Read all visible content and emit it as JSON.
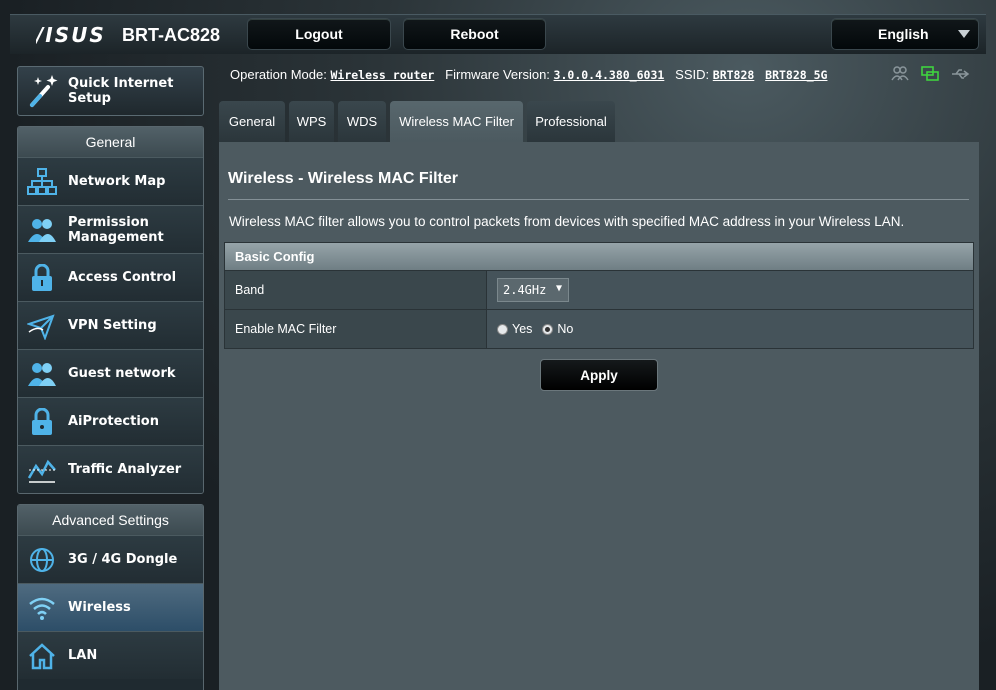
{
  "header": {
    "logo": "/ISUS",
    "model": "BRT-AC828",
    "logout_label": "Logout",
    "reboot_label": "Reboot",
    "language": "English"
  },
  "info": {
    "operation_mode_label": "Operation Mode:",
    "operation_mode": "Wireless router",
    "firmware_label": "Firmware Version:",
    "firmware": "3.0.0.4.380_6031",
    "ssid_label": "SSID:",
    "ssid_1": "BRT828",
    "ssid_2": "BRT828_5G"
  },
  "sidebar": {
    "qis_label_1": "Quick Internet",
    "qis_label_2": "Setup",
    "general_header": "General",
    "general_items": [
      {
        "label": "Network Map"
      },
      {
        "label_1": "Permission",
        "label_2": "Management"
      },
      {
        "label": "Access Control"
      },
      {
        "label": "VPN Setting"
      },
      {
        "label": "Guest network"
      },
      {
        "label": "AiProtection"
      },
      {
        "label": "Traffic Analyzer"
      }
    ],
    "advanced_header": "Advanced Settings",
    "advanced_items": [
      {
        "label": "3G / 4G Dongle"
      },
      {
        "label": "Wireless"
      },
      {
        "label": "LAN"
      }
    ]
  },
  "tabs": [
    {
      "label": "General"
    },
    {
      "label": "WPS"
    },
    {
      "label": "WDS"
    },
    {
      "label": "Wireless MAC Filter"
    },
    {
      "label": "Professional"
    }
  ],
  "main": {
    "title": "Wireless - Wireless MAC Filter",
    "description": "Wireless MAC filter allows you to control packets from devices with specified MAC address in your Wireless LAN.",
    "section_header": "Basic Config",
    "band_label": "Band",
    "band_value": "2.4GHz",
    "enable_label": "Enable MAC Filter",
    "yes_label": "Yes",
    "no_label": "No",
    "apply_label": "Apply"
  },
  "colors": {
    "accent": "#4fb3e8",
    "active_menu": "#3d5b74",
    "panel": "#4d5a60"
  }
}
